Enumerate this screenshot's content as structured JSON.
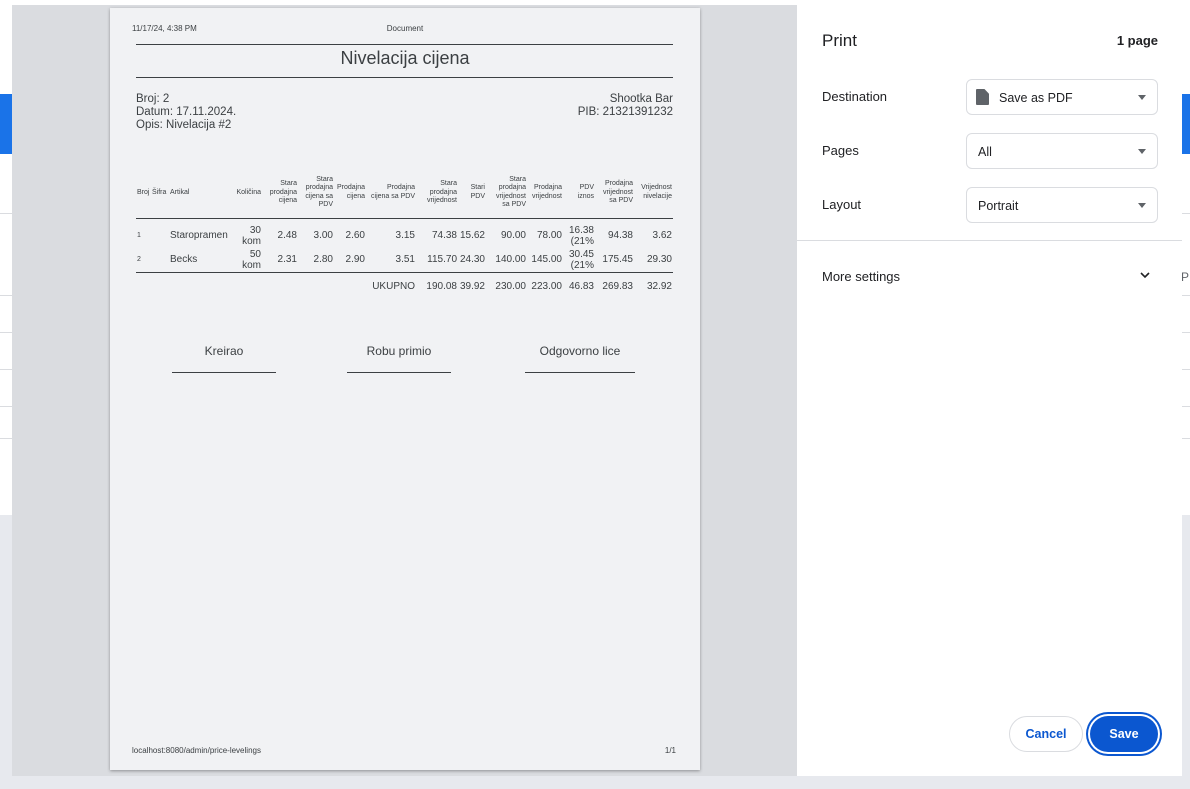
{
  "document": {
    "header_date": "11/17/24, 4:38 PM",
    "header_title": "Document",
    "title": "Nivelacija cijena",
    "meta": {
      "broj": "Broj: 2",
      "datum": "Datum: 17.11.2024.",
      "opis": "Opis: Nivelacija #2",
      "company": "Shootka Bar",
      "pib": "PIB: 21321391232"
    },
    "columns": [
      "Broj",
      "Šifra",
      "Artikal",
      "Količina",
      "Stara prodajna cijena",
      "Stara prodajna cijena sa PDV",
      "Prodajna cijena",
      "Prodajna cijena sa PDV",
      "Stara prodajna vrijednost",
      "Stari PDV",
      "Stara prodajna vrijednost sa PDV",
      "Prodajna vrijednost",
      "PDV iznos",
      "Prodajna vrijednost sa PDV",
      "Vrijednost nivelacije"
    ],
    "rows": [
      [
        "1",
        "",
        "Staropramen",
        "30 kom",
        "2.48",
        "3.00",
        "2.60",
        "3.15",
        "74.38",
        "15.62",
        "90.00",
        "78.00",
        "16.38 (21%",
        "94.38",
        "3.62"
      ],
      [
        "2",
        "",
        "Becks",
        "50 kom",
        "2.31",
        "2.80",
        "2.90",
        "3.51",
        "115.70",
        "24.30",
        "140.00",
        "145.00",
        "30.45 (21%",
        "175.45",
        "29.30"
      ]
    ],
    "totals": {
      "label": "UKUPNO",
      "values": [
        "190.08",
        "39.92",
        "230.00",
        "223.00",
        "46.83",
        "269.83",
        "32.92"
      ]
    },
    "signatures": [
      "Kreirao",
      "Robu primio",
      "Odgovorno lice"
    ],
    "footer_url": "localhost:8080/admin/price-levelings",
    "footer_page": "1/1"
  },
  "panel": {
    "title": "Print",
    "page_count": "1 page",
    "destination_label": "Destination",
    "destination_value": "Save as PDF",
    "pages_label": "Pages",
    "pages_value": "All",
    "layout_label": "Layout",
    "layout_value": "Portrait",
    "more_settings": "More settings",
    "cancel": "Cancel",
    "save": "Save"
  },
  "background": {
    "partial_text": "PI"
  },
  "colors": {
    "accent": "#0b57d0",
    "app_blue": "#1a73e8"
  }
}
